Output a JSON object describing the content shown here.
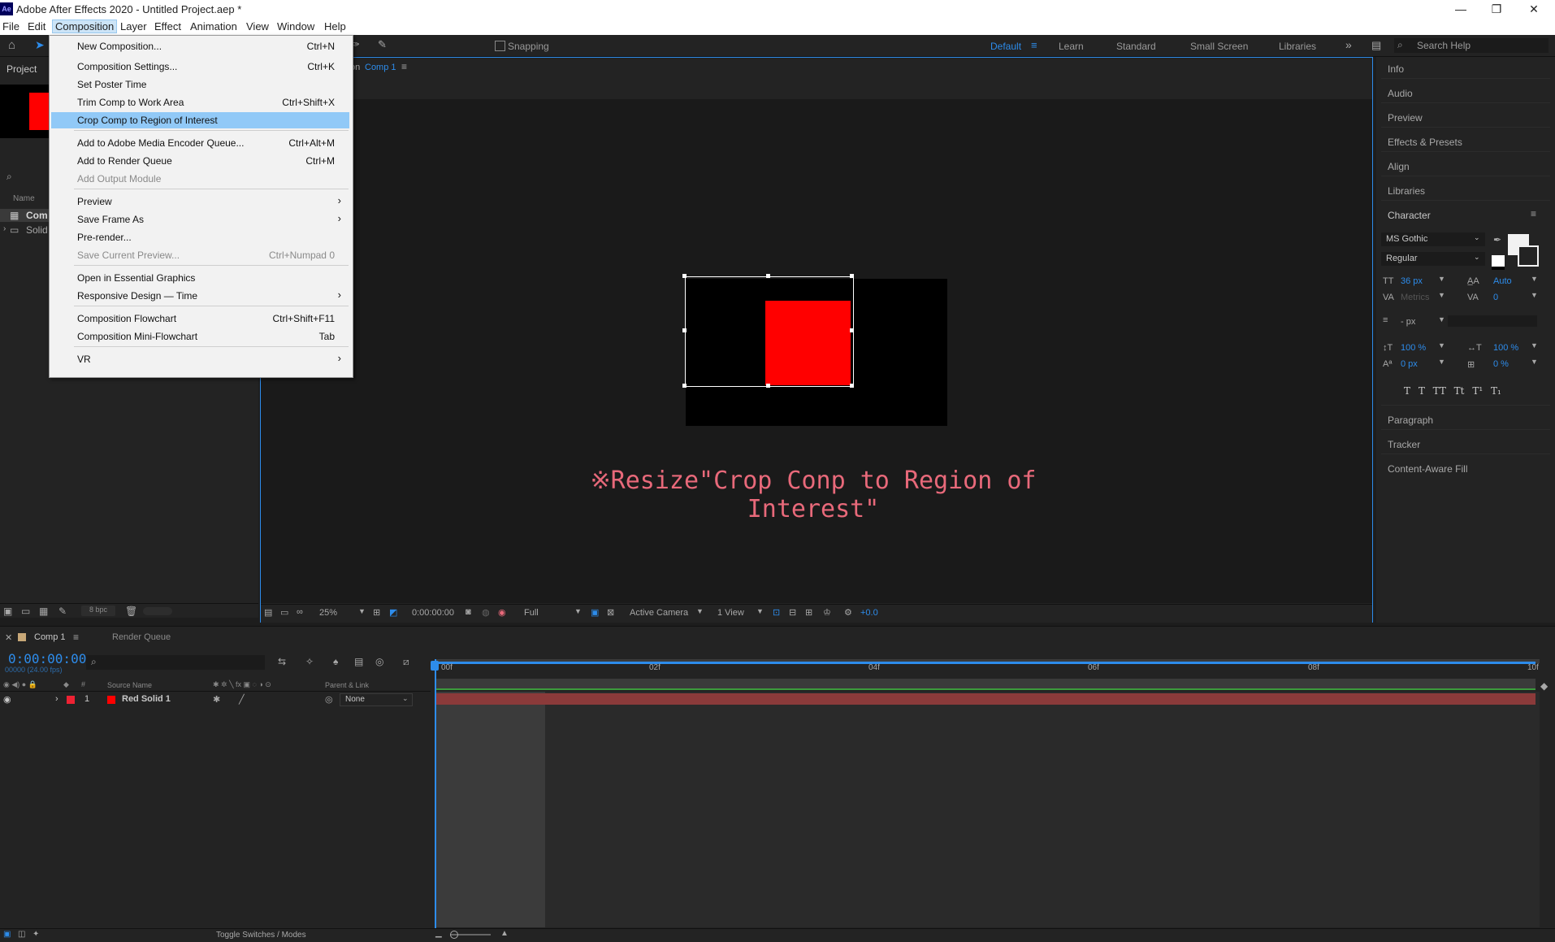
{
  "window": {
    "logo": "Ae",
    "title": "Adobe After Effects 2020 - Untitled Project.aep *",
    "controls": [
      "—",
      "❐",
      "✕"
    ]
  },
  "menubar": [
    "File",
    "Edit",
    "Composition",
    "Layer",
    "Effect",
    "Animation",
    "View",
    "Window",
    "Help"
  ],
  "toolbar": {
    "snapping": "Snapping",
    "workspaces": [
      "Default",
      "Learn",
      "Standard",
      "Small Screen",
      "Libraries"
    ],
    "active_workspace": "Default",
    "search_placeholder": "Search Help"
  },
  "project_panel": {
    "title": "Project",
    "col_name": "Name",
    "items": [
      "Com",
      "Solid"
    ],
    "bpc": "8 bpc"
  },
  "comp_panel": {
    "tab_prefix": "on",
    "tab": "Comp 1",
    "annotation": "※Resize\"Crop Conp to Region of Interest\""
  },
  "comp_footer": {
    "zoom": "25%",
    "timecode": "0:00:00:00",
    "resolution": "Full",
    "camera": "Active Camera",
    "views": "1 View",
    "exposure": "+0.0"
  },
  "composition_menu": [
    {
      "label": "New Composition...",
      "shortcut": "Ctrl+N"
    },
    {
      "label": "Composition Settings...",
      "shortcut": "Ctrl+K"
    },
    {
      "label": "Set Poster Time",
      "shortcut": ""
    },
    {
      "label": "Trim Comp to Work Area",
      "shortcut": "Ctrl+Shift+X"
    },
    {
      "label": "Crop Comp to Region of Interest",
      "shortcut": "",
      "highlighted": true
    },
    {
      "label": "Add to Adobe Media Encoder Queue...",
      "shortcut": "Ctrl+Alt+M"
    },
    {
      "label": "Add to Render Queue",
      "shortcut": "Ctrl+M"
    },
    {
      "label": "Add Output Module",
      "shortcut": "",
      "disabled": true
    },
    {
      "label": "Preview",
      "submenu": true
    },
    {
      "label": "Save Frame As",
      "submenu": true
    },
    {
      "label": "Pre-render...",
      "shortcut": ""
    },
    {
      "label": "Save Current Preview...",
      "shortcut": "Ctrl+Numpad 0",
      "disabled": true
    },
    {
      "label": "Open in Essential Graphics",
      "shortcut": ""
    },
    {
      "label": "Responsive Design — Time",
      "submenu": true
    },
    {
      "label": "Composition Flowchart",
      "shortcut": "Ctrl+Shift+F11"
    },
    {
      "label": "Composition Mini-Flowchart",
      "shortcut": "Tab"
    },
    {
      "label": "VR",
      "submenu": true
    }
  ],
  "right_panel": {
    "items_top": [
      "Info",
      "Audio",
      "Preview",
      "Effects & Presets",
      "Align",
      "Libraries"
    ],
    "character": {
      "title": "Character",
      "font": "MS Gothic",
      "style": "Regular",
      "size": "36 px",
      "leading": "Auto",
      "kerning": "Metrics",
      "tracking": "0",
      "stroke": "- px",
      "v_scale": "100 %",
      "h_scale": "100 %",
      "baseline": "0 px",
      "tsume": "0 %",
      "type_buttons": "T  T  TT  Tt  T¹  T₁"
    },
    "items_bottom": [
      "Paragraph",
      "Tracker",
      "Content-Aware Fill"
    ]
  },
  "timeline": {
    "tab": "Comp 1",
    "render_queue": "Render Queue",
    "timecode": "0:00:00:00",
    "fps": "00000 (24.00 fps)",
    "col_source": "Source Name",
    "col_parent": "Parent & Link",
    "ruler": [
      "00f",
      "02f",
      "04f",
      "06f",
      "08f",
      "10f"
    ],
    "layer": {
      "index": "1",
      "name": "Red Solid 1",
      "parent": "None"
    },
    "footer": "Toggle Switches / Modes"
  },
  "colors": {
    "accent": "#2d8ceb",
    "solid": "#ff0000",
    "annotation": "#e8697a",
    "layer_bar": "#8b3a3a",
    "highlight": "#91c9f7"
  }
}
